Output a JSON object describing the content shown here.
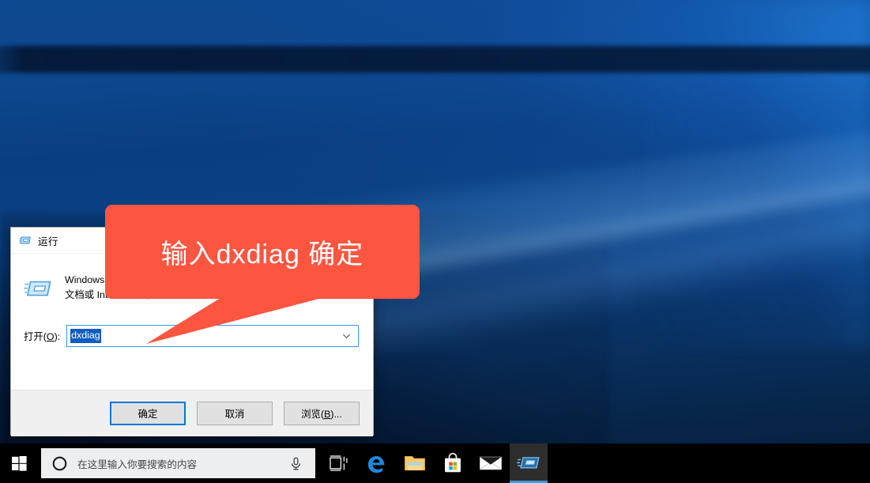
{
  "desktop": {
    "wallpaper_name": "windows-10-hero-wallpaper",
    "colors": {
      "deep_blue": "#0a3e80",
      "dark_blue": "#061d3a",
      "light_ray": "#96cdff"
    }
  },
  "run_dialog": {
    "title": "运行",
    "title_icon": "run-app-icon",
    "description": "Windows 将根据你所输入的名称，为你打开相应的程序、文件夹、文档或 Internet 资源。",
    "open_label_prefix": "打开(",
    "open_label_accel": "O",
    "open_label_suffix": "):",
    "input_value": "dxdiag",
    "input_placeholder": "",
    "input_selected": true,
    "combo_arrow_icon": "chevron-down-icon",
    "buttons": {
      "ok": "确定",
      "cancel": "取消",
      "browse_prefix": "浏览(",
      "browse_accel": "B",
      "browse_suffix": ")..."
    },
    "accent": "#0078d7"
  },
  "callout": {
    "text": "输入dxdiag 确定",
    "color": "#fc5540",
    "text_color": "#ffffff"
  },
  "taskbar": {
    "start_icon": "windows-start-icon",
    "search": {
      "placeholder": "在这里输入你要搜索的内容",
      "cortana_icon": "cortana-circle-icon",
      "mic_icon": "microphone-icon"
    },
    "task_view_icon": "task-view-icon",
    "items": [
      {
        "name": "edge",
        "icon": "edge-icon",
        "label": "Microsoft Edge",
        "active": false
      },
      {
        "name": "file-explorer",
        "icon": "folder-icon",
        "label": "文件资源管理器",
        "active": false
      },
      {
        "name": "microsoft-store",
        "icon": "store-bag-icon",
        "label": "Microsoft Store",
        "active": false
      },
      {
        "name": "mail",
        "icon": "envelope-icon",
        "label": "邮件",
        "active": false
      },
      {
        "name": "run",
        "icon": "run-app-icon",
        "label": "运行",
        "active": true
      }
    ],
    "active_indicator_color": "#3b9ae1",
    "background": "#000000"
  }
}
